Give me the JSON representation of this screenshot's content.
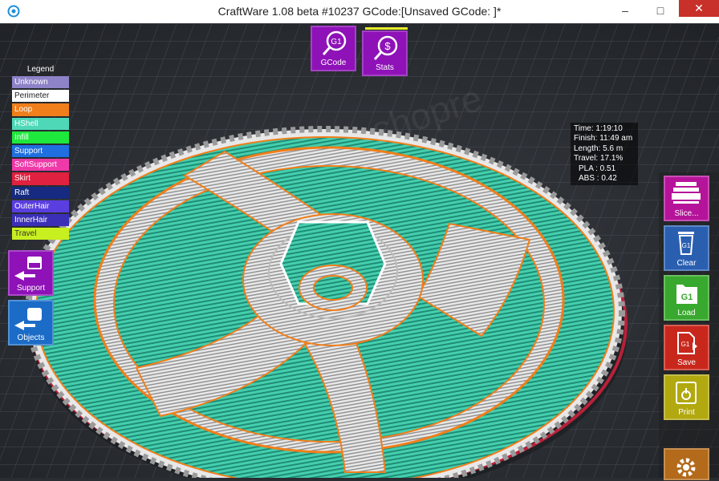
{
  "window": {
    "title": "CraftWare 1.08 beta #10237   GCode:[Unsaved GCode: ]*",
    "minimize": "–",
    "maximize": "□",
    "close": "✕"
  },
  "legend": {
    "title": "Legend",
    "items": [
      {
        "label": "Unknown",
        "color": "#8e82c8",
        "text": "#ffffff"
      },
      {
        "label": "Perimeter",
        "color": "#ffffff",
        "text": "#222222"
      },
      {
        "label": "Loop",
        "color": "#f07e1a",
        "text": "#ffffff"
      },
      {
        "label": "HShell",
        "color": "#4fd8b8",
        "text": "#ffffff"
      },
      {
        "label": "Infill",
        "color": "#1ee83c",
        "text": "#ffffff"
      },
      {
        "label": "Support",
        "color": "#1f6fe0",
        "text": "#ffffff"
      },
      {
        "label": "SoftSupport",
        "color": "#ee3aa8",
        "text": "#ffffff"
      },
      {
        "label": "Skirt",
        "color": "#e0213f",
        "text": "#ffffff"
      },
      {
        "label": "Raft",
        "color": "#152a80",
        "text": "#ffffff"
      },
      {
        "label": "OuterHair",
        "color": "#5a3ee0",
        "text": "#ffffff"
      },
      {
        "label": "InnerHair",
        "color": "#3b2fb8",
        "text": "#ffffff"
      },
      {
        "label": "Travel",
        "color": "#c8f020",
        "text": "#333333"
      }
    ]
  },
  "top_buttons": {
    "gcode": {
      "label": "GCode",
      "glyph": "G1",
      "icon": "magnifier-gcode-icon"
    },
    "stats": {
      "label": "Stats",
      "glyph": "$",
      "icon": "magnifier-dollar-icon"
    }
  },
  "left_buttons": {
    "support": {
      "label": "Support",
      "color": "#8e12b7",
      "icon": "support-arrow-icon"
    },
    "objects": {
      "label": "Objects",
      "color": "#1b6cc7",
      "icon": "objects-arrow-icon"
    }
  },
  "stats": {
    "time": "Time: 1:19:10",
    "finish": "Finish: 11:49 am",
    "length": "Length: 5.6 m",
    "travel": "Travel: 17.1%",
    "pla": "PLA : 0.51",
    "abs": "ABS : 0.42"
  },
  "right_buttons": {
    "slice": {
      "label": "Slice...",
      "color": "#b5149a",
      "icon": "printer-slice-icon"
    },
    "clear": {
      "label": "Clear",
      "color": "#2a5fb0",
      "icon": "trash-gcode-icon",
      "glyph": "G1"
    },
    "load": {
      "label": "Load",
      "color": "#39a82e",
      "icon": "folder-gcode-icon",
      "glyph": "G1"
    },
    "save": {
      "label": "Save",
      "color": "#c8281c",
      "icon": "save-gcode-icon",
      "glyph": "G1"
    },
    "print": {
      "label": "Print",
      "color": "#b2a810",
      "icon": "print-icon"
    },
    "settings": {
      "label": "",
      "color": "#b36a1a",
      "icon": "gear-icon"
    }
  },
  "scene": {
    "watermark": "shopre"
  }
}
